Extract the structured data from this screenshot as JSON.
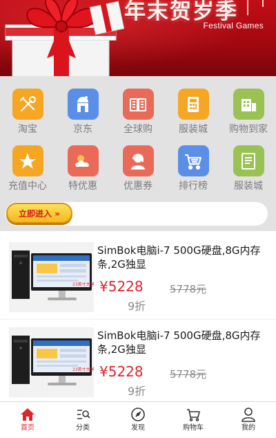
{
  "banner": {
    "title": "年末贺岁季",
    "subtitle": "Festival Games"
  },
  "categories": [
    {
      "label": "淘宝",
      "color": "#f5a623",
      "icon": "tools-icon"
    },
    {
      "label": "京东",
      "color": "#5b8ee6",
      "icon": "store-icon"
    },
    {
      "label": "全球购",
      "color": "#ea6a5a",
      "icon": "book-icon"
    },
    {
      "label": "服装城",
      "color": "#f5a623",
      "icon": "calculator-icon"
    },
    {
      "label": "购物到家",
      "color": "#9ac253",
      "icon": "shop-icon"
    },
    {
      "label": "充值中心",
      "color": "#f5a623",
      "icon": "star-icon"
    },
    {
      "label": "特优惠",
      "color": "#ea6a5a",
      "icon": "weather-icon"
    },
    {
      "label": "优惠券",
      "color": "#ea6a5a",
      "icon": "support-icon"
    },
    {
      "label": "排行榜",
      "color": "#5b8ee6",
      "icon": "cart-icon"
    },
    {
      "label": "服装城",
      "color": "#9ac253",
      "icon": "list-icon"
    }
  ],
  "enter_button": {
    "label": "立即进入 »"
  },
  "products": [
    {
      "name": "SimBok电脑i-7 500G硬盘,8G内存条,2G独显",
      "price": "¥5228",
      "original_price": "5778元",
      "discount": "9折",
      "screen_caption": "23英寸大屏"
    },
    {
      "name": "SimBok电脑i-7 500G硬盘,8G内存条,2G独显",
      "price": "¥5228",
      "original_price": "5778元",
      "discount": "9折",
      "screen_caption": "23英寸大屏"
    }
  ],
  "tabbar": [
    {
      "label": "首页",
      "icon": "home-icon",
      "active": true
    },
    {
      "label": "分类",
      "icon": "category-icon",
      "active": false
    },
    {
      "label": "发现",
      "icon": "compass-icon",
      "active": false
    },
    {
      "label": "购物车",
      "icon": "cart-icon",
      "active": false
    },
    {
      "label": "我的",
      "icon": "user-icon",
      "active": false
    }
  ],
  "colors": {
    "brand_red": "#e0242c",
    "banner_red": "#b00a12",
    "grid_bg": "#e2e2e2"
  }
}
